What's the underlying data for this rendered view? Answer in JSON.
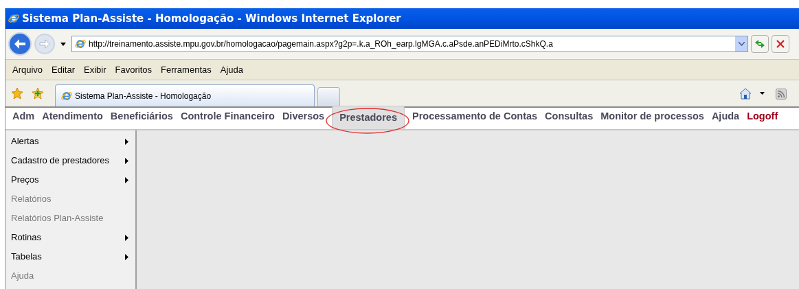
{
  "window": {
    "title": "Sistema Plan-Assiste - Homologação - Windows Internet Explorer"
  },
  "address_bar": {
    "value": "http://treinamento.assiste.mpu.gov.br/homologacao/pagemain.aspx?g2p=.k.a_ROh_earp.lgMGA.c.aPsde.anPEDiMrto.cShkQ.a"
  },
  "menu_bar": [
    "Arquivo",
    "Editar",
    "Exibir",
    "Favoritos",
    "Ferramentas",
    "Ajuda"
  ],
  "tabs": [
    {
      "label": "Sistema Plan-Assiste - Homologação",
      "selected": true
    }
  ],
  "nav": [
    {
      "label": "Adm",
      "selected": false,
      "kind": "link"
    },
    {
      "label": "Atendimento",
      "selected": false,
      "kind": "link"
    },
    {
      "label": "Beneficiários",
      "selected": false,
      "kind": "link"
    },
    {
      "label": "Controle Financeiro",
      "selected": false,
      "kind": "link"
    },
    {
      "label": "Diversos",
      "selected": false,
      "kind": "link"
    },
    {
      "label": "Prestadores",
      "selected": true,
      "kind": "link"
    },
    {
      "label": "Processamento de Contas",
      "selected": false,
      "kind": "link"
    },
    {
      "label": "Consultas",
      "selected": false,
      "kind": "link"
    },
    {
      "label": "Monitor de processos",
      "selected": false,
      "kind": "link"
    },
    {
      "label": "Ajuda",
      "selected": false,
      "kind": "link"
    },
    {
      "label": "Logoff",
      "selected": false,
      "kind": "logoff"
    }
  ],
  "sidebar": {
    "items": [
      {
        "label": "Alertas",
        "has_submenu": true,
        "disabled": false
      },
      {
        "label": "Cadastro de prestadores",
        "has_submenu": true,
        "disabled": false
      },
      {
        "label": "Preços",
        "has_submenu": true,
        "disabled": false
      },
      {
        "label": "Relatórios",
        "has_submenu": false,
        "disabled": true
      },
      {
        "label": "Relatórios Plan-Assiste",
        "has_submenu": false,
        "disabled": true
      },
      {
        "label": "Rotinas",
        "has_submenu": true,
        "disabled": false
      },
      {
        "label": "Tabelas",
        "has_submenu": true,
        "disabled": false
      },
      {
        "label": "Ajuda",
        "has_submenu": false,
        "disabled": true
      }
    ]
  }
}
